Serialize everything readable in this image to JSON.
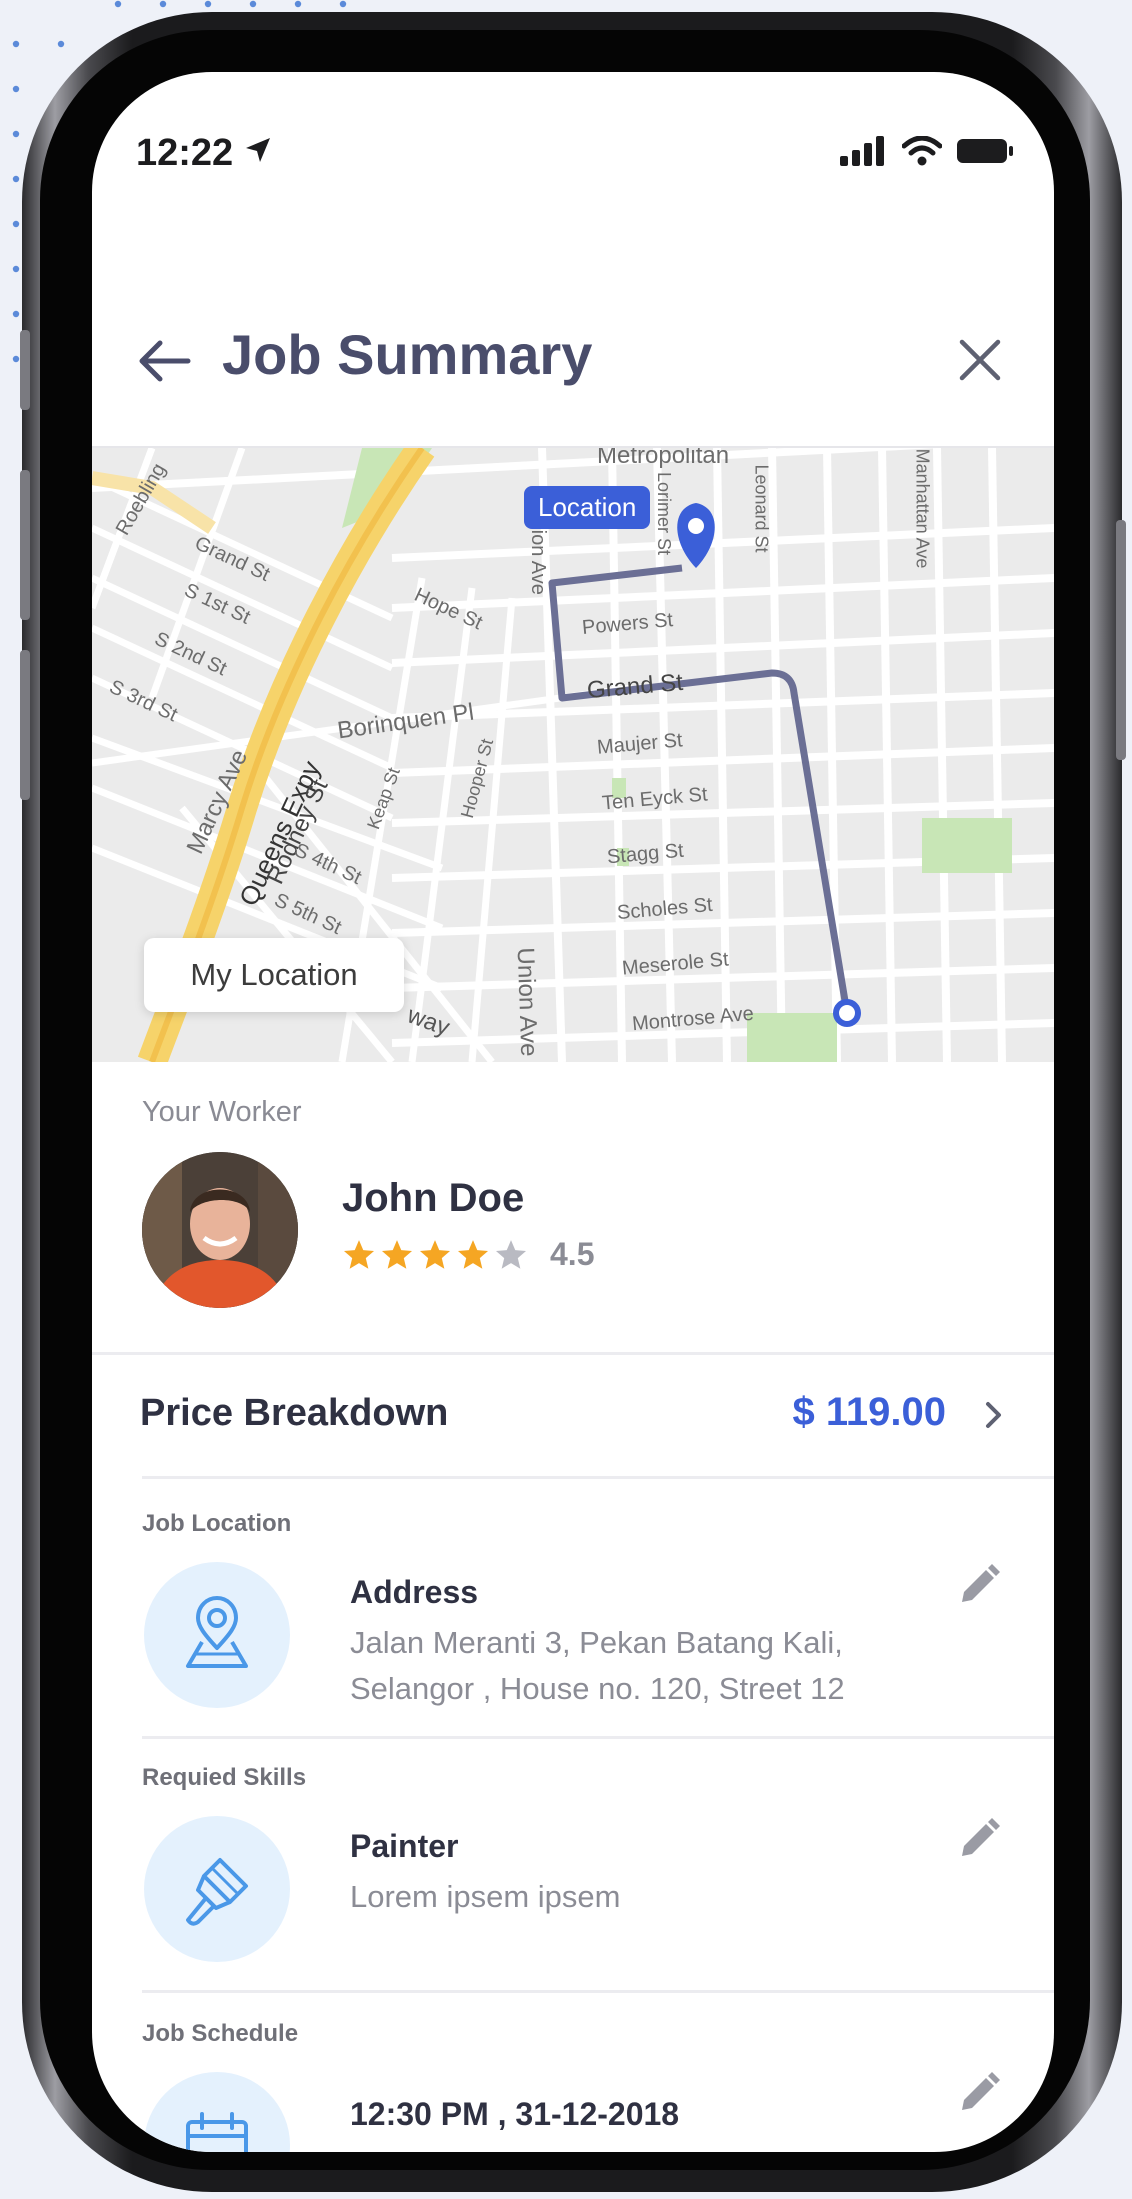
{
  "status_bar": {
    "time": "12:22"
  },
  "header": {
    "title": "Job Summary"
  },
  "map": {
    "location_tag": "Location",
    "my_location_button": "My Location",
    "street_labels": {
      "metropolitan": "Metropolitan",
      "roebling": "Roebling",
      "grand_st_left": "Grand St",
      "s1st": "S 1st St",
      "s2nd": "S 2nd St",
      "s3rd": "S 3rd St",
      "hope": "Hope St",
      "borinquen": "Borinquen Pl",
      "marcy": "Marcy Ave",
      "queens": "Queens Expy",
      "rodney": "Rodney St",
      "s4th": "S 4th St",
      "s5th": "S 5th St",
      "keap": "Keap St",
      "hooper": "Hooper St",
      "union_top": "Union Ave",
      "union_bottom": "Union Ave",
      "lorimer": "Lorimer St",
      "leonard": "Leonard St",
      "manhattan": "Manhattan Ave",
      "powers": "Powers St",
      "grand_st": "Grand St",
      "maujer": "Maujer St",
      "ten_eyck": "Ten Eyck St",
      "stagg": "Stagg St",
      "scholes": "Scholes St",
      "meserole": "Meserole St",
      "montrose": "Montrose Ave",
      "broadway": "way"
    }
  },
  "worker": {
    "heading": "Your Worker",
    "name": "John Doe",
    "rating": 4.5,
    "rating_text": "4.5"
  },
  "price": {
    "label": "Price Breakdown",
    "amount": "$ 119.00"
  },
  "sections": {
    "location": {
      "label": "Job Location",
      "title": "Address",
      "desc_line1": "Jalan Meranti 3, Pekan Batang Kali,",
      "desc_line2": "Selangor , House no. 120, Street 12",
      "icon": "map-pin-icon"
    },
    "skills": {
      "label": "Requied Skills",
      "title": "Painter",
      "desc": "Lorem ipsem ipsem",
      "icon": "paint-brush-icon"
    },
    "schedule": {
      "label": "Job Schedule",
      "title": "12:30 PM , 31-12-2018",
      "icon": "calendar-icon"
    }
  },
  "colors": {
    "accent": "#3b5fd8",
    "route": "#6b6f95",
    "star": "#f5a623",
    "star_empty": "#b9bac2",
    "title": "#4a4d6b",
    "icon_bg": "#e4f1fd"
  }
}
